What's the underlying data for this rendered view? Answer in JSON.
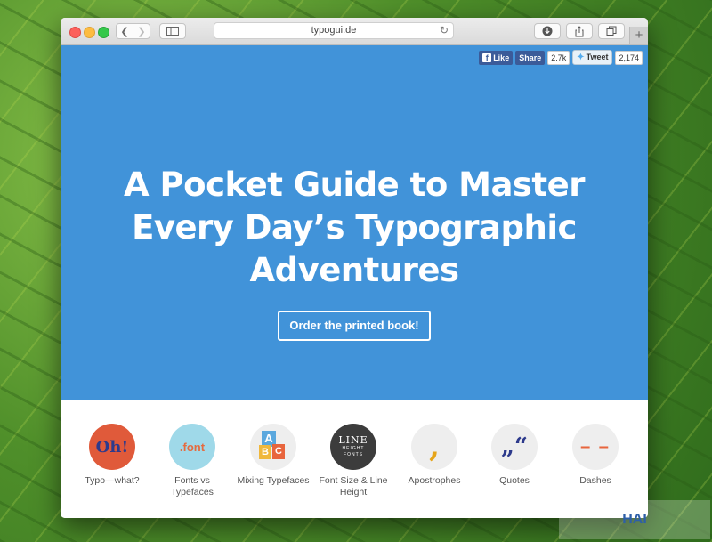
{
  "browser": {
    "url": "typogui.de",
    "new_tab": "+"
  },
  "social": {
    "like_label": "Like",
    "share_label": "Share",
    "share_count": "2.7k",
    "tweet_label": "Tweet",
    "tweet_count": "2,174"
  },
  "hero": {
    "headline_line1": "A Pocket Guide to Master",
    "headline_line2": "Every Day’s Typographic",
    "headline_line3": "Adventures",
    "cta_label": "Order the printed book!",
    "background_color": "#4193d9"
  },
  "topics": [
    {
      "label": "Typo—what?",
      "icon_text": "Oh!",
      "icon": "oh-icon"
    },
    {
      "label": "Fonts vs Typefaces",
      "icon_text": ".font",
      "icon": "font-icon"
    },
    {
      "label": "Mixing Typefaces",
      "icon_text": "ABC",
      "icon": "letter-blocks-icon"
    },
    {
      "label": "Font Size & Line Height",
      "icon_text": "LINE HEIGHT FONTS",
      "icon": "line-height-icon"
    },
    {
      "label": "Apostrophes",
      "icon_text": ",",
      "icon": "apostrophe-icon"
    },
    {
      "label": "Quotes",
      "icon_text": "„“",
      "icon": "quotes-icon"
    },
    {
      "label": "Dashes",
      "icon_text": "– –",
      "icon": "dashes-icon"
    }
  ]
}
